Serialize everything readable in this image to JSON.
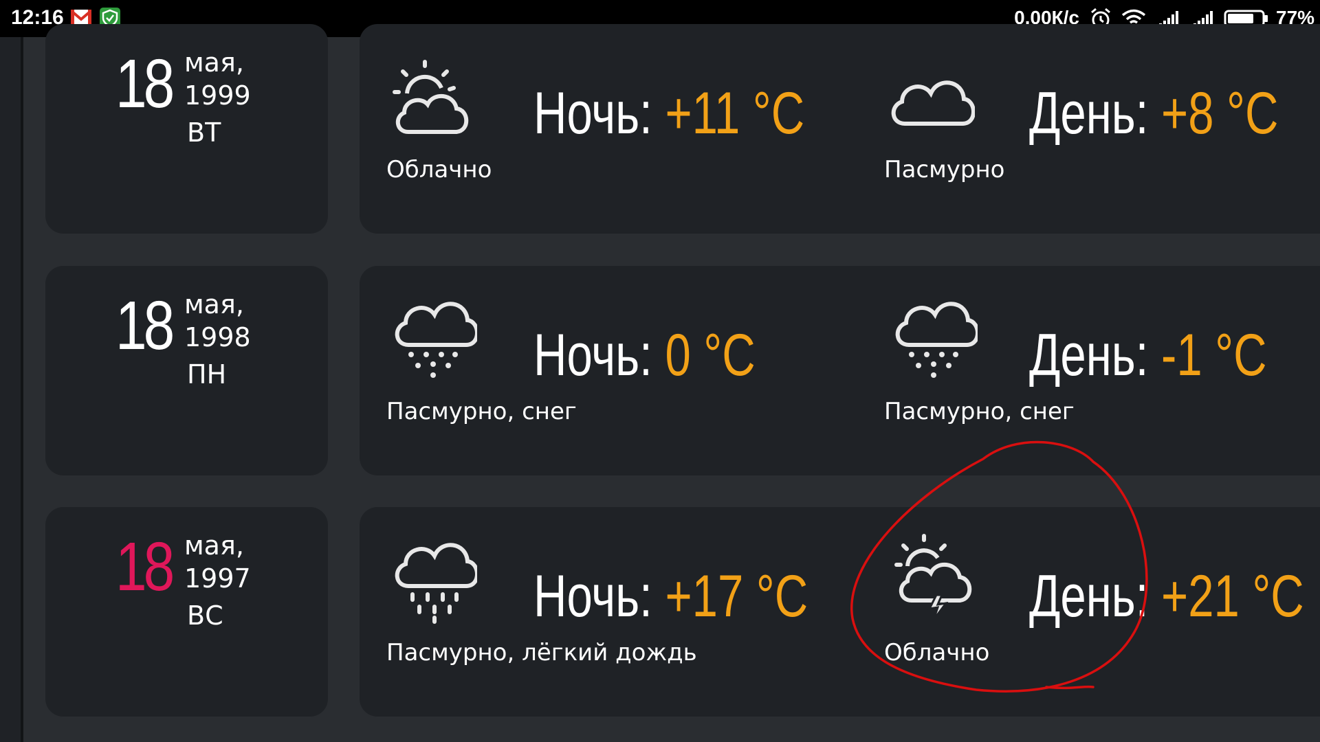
{
  "status_bar": {
    "time": "12:16",
    "network_speed": "0,00К/с",
    "battery_percent": "77%",
    "icons": [
      "gmail-icon",
      "shield-icon",
      "alarm-icon",
      "wifi-icon",
      "signal-icon",
      "signal-icon",
      "battery-icon"
    ],
    "battery_level": 0.77
  },
  "colors": {
    "temperature": "#f2a117",
    "sunday": "#e0175a",
    "card_bg": "#1f2226",
    "page_bg": "#2a2d31",
    "annotation": "#d90f0f"
  },
  "labels": {
    "night": "Ночь:",
    "day": "День:"
  },
  "rows": [
    {
      "day": "18",
      "month": "мая,",
      "year": "1999",
      "weekday": "ВТ",
      "night": {
        "icon": "partly-cloudy-icon",
        "desc": "Облачно",
        "temp": "+11 °C"
      },
      "daytime": {
        "icon": "cloud-icon",
        "desc": "Пасмурно",
        "temp": "+8 °C"
      }
    },
    {
      "day": "18",
      "month": "мая,",
      "year": "1998",
      "weekday": "ПН",
      "night": {
        "icon": "snow-cloud-icon",
        "desc": "Пасмурно, снег",
        "temp": "0 °C"
      },
      "daytime": {
        "icon": "snow-cloud-icon",
        "desc": "Пасмурно, снег",
        "temp": "-1 °C"
      }
    },
    {
      "day": "18",
      "month": "мая,",
      "year": "1997",
      "weekday": "ВС",
      "night": {
        "icon": "rain-cloud-icon",
        "desc": "Пасмурно, лёгкий дождь",
        "temp": "+17 °C"
      },
      "daytime": {
        "icon": "thunder-partly-cloudy-icon",
        "desc": "Облачно",
        "temp": "+21 °C"
      }
    }
  ]
}
